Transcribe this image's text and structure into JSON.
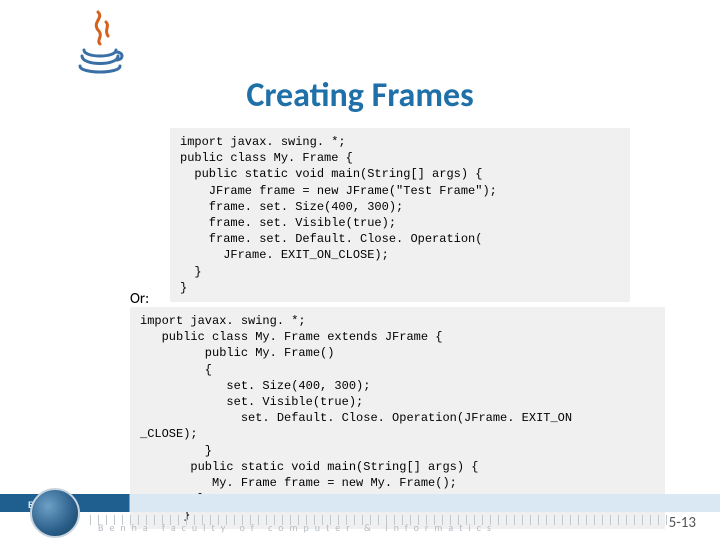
{
  "title": "Creating Frames",
  "code1": "import javax. swing. *;\npublic class My. Frame {\n  public static void main(String[] args) {\n    JFrame frame = new JFrame(\"Test Frame\");\n    frame. set. Size(400, 300);\n    frame. set. Visible(true);\n    frame. set. Default. Close. Operation(\n      JFrame. EXIT_ON_CLOSE);\n  }\n}",
  "or_label": "Or:",
  "code2": "import javax. swing. *;\n   public class My. Frame extends JFrame {\n         public My. Frame()\n         {\n            set. Size(400, 300);\n            set. Visible(true);\n              set. Default. Close. Operation(JFrame. EXIT_ON\n_CLOSE);\n         }\n       public static void main(String[] args) {\n          My. Frame frame = new My. Frame();\n        }\n      }",
  "footer": {
    "bfci": "B F C I",
    "org": "Benha  faculty  of  computer  &  Informatics",
    "page": "5-13"
  }
}
